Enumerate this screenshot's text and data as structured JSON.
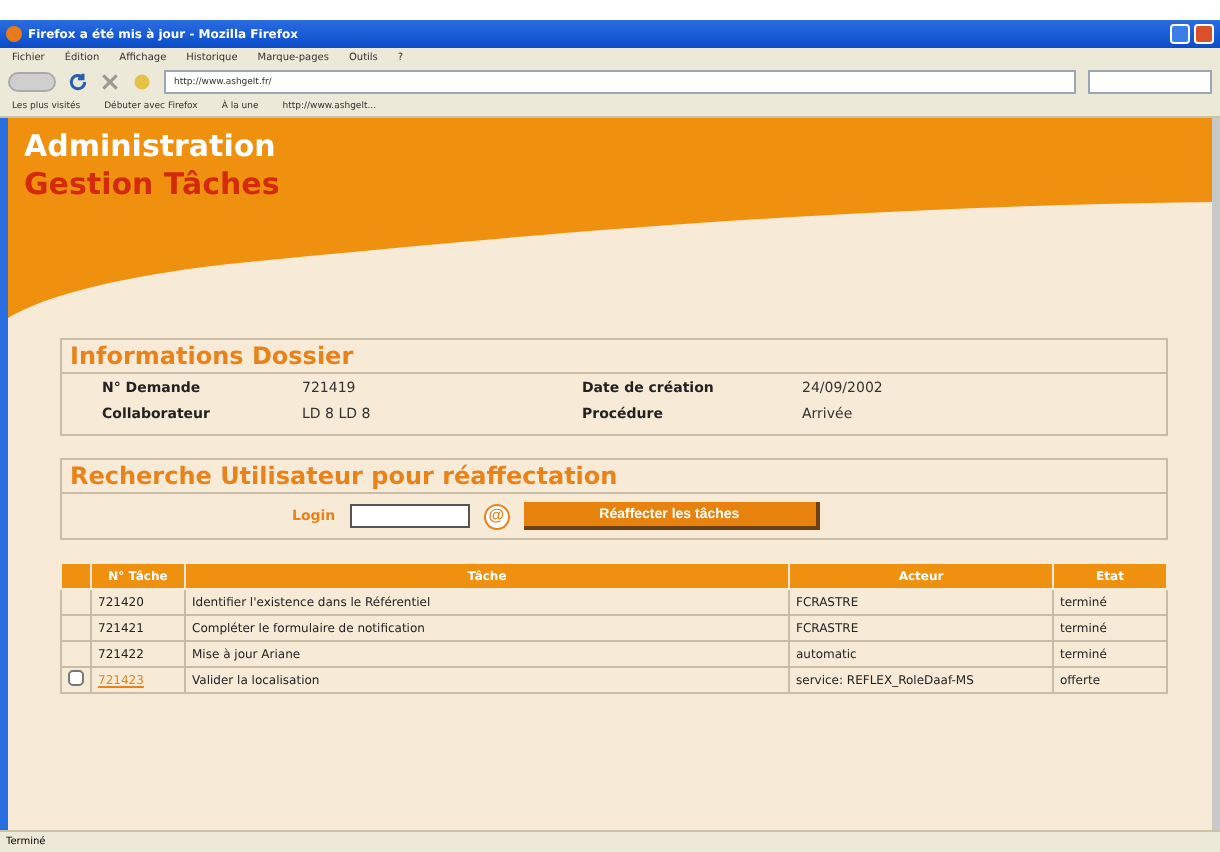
{
  "window": {
    "title": "Firefox a été mis à jour - Mozilla Firefox"
  },
  "menu": [
    "Fichier",
    "Édition",
    "Affichage",
    "Historique",
    "Marque-pages",
    "Outils",
    "?"
  ],
  "address": {
    "url": "http://www.ashgelt.fr/"
  },
  "bookmarks": [
    "Les plus visités",
    "Débuter avec Firefox",
    "À la une",
    "http://www.ashgelt..."
  ],
  "header": {
    "title": "Administration",
    "subtitle": "Gestion Tâches"
  },
  "dossier": {
    "title": "Informations Dossier",
    "fields": [
      {
        "label": "N° Demande",
        "value": "721419"
      },
      {
        "label": "Date de création",
        "value": "24/09/2002"
      },
      {
        "label": "Collaborateur",
        "value": "LD 8 LD 8"
      },
      {
        "label": "Procédure",
        "value": "Arrivée"
      }
    ]
  },
  "recherche": {
    "title": "Recherche Utilisateur pour réaffectation",
    "login_label": "Login",
    "search_icon_text": "@",
    "button": "Réaffecter les tâches"
  },
  "table": {
    "columns": [
      "N° Tâche",
      "Tâche",
      "Acteur",
      "Etat"
    ],
    "rows": [
      {
        "number": "721420",
        "task": "Identifier l'existence dans le Référentiel",
        "actor": "FCRASTRE",
        "state": "terminé",
        "link": false
      },
      {
        "number": "721421",
        "task": "Compléter le formulaire de notification",
        "actor": "FCRASTRE",
        "state": "terminé",
        "link": false
      },
      {
        "number": "721422",
        "task": "Mise à jour Ariane",
        "actor": "automatic",
        "state": "terminé",
        "link": false
      },
      {
        "number": "721423",
        "task": "Valider la localisation",
        "actor": "service: REFLEX_RoleDaaf-MS",
        "state": "offerte",
        "link": true,
        "checkbox": {
          "checked": false
        }
      }
    ]
  },
  "status_bar": {
    "text": "Terminé"
  }
}
